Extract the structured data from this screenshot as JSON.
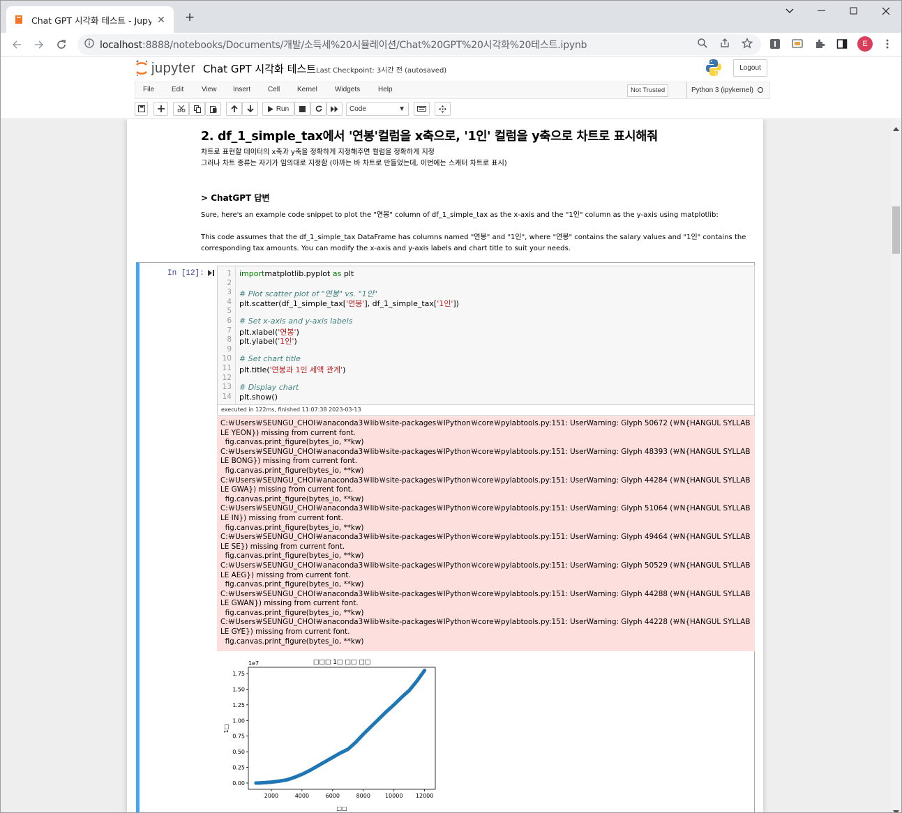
{
  "browser": {
    "tab_title": "Chat GPT 시각화 테스트 - Jupyter Notebook",
    "tab_close": "✕",
    "new_tab": "+",
    "url_host": "localhost",
    "url_path": ":8888/notebooks/Documents/개발/소득세%20시뮬레이션/Chat%20GPT%20시각화%20테스트.ipynb",
    "profile_initial": "E"
  },
  "jupyter": {
    "logo_text": "jupyter",
    "notebook_name": "Chat GPT 시각화 테스트",
    "checkpoint": "Last Checkpoint: 3시간 전   (autosaved)",
    "logout": "Logout",
    "menu": [
      "File",
      "Edit",
      "View",
      "Insert",
      "Cell",
      "Kernel",
      "Widgets",
      "Help"
    ],
    "not_trusted": "Not Trusted",
    "kernel": "Python 3 (ipykernel)",
    "run_label": "Run",
    "cell_type": "Code"
  },
  "markdown": {
    "heading": "2. df_1_simple_tax에서 '연봉'컬럼을 x축으로, '1인' 컬럼을 y축으로 차트로 표시해줘",
    "note1": "차트로 표현할 데이터의 x축과 y축을 정확하게 지정해주면 컬럼을 정확하게 지정",
    "note2": "그러나 차트 종류는 자기가 임의대로 지정함 (아까는 바 차트로 만들었는데, 이번에는 스캐터 차트로 표시)",
    "subheading": "> ChatGPT 답변",
    "para1": "Sure, here's an example code snippet to plot the \"연봉\" column of df_1_simple_tax as the x-axis and the \"1인\" column as the y-axis using matplotlib:",
    "para2a": "This code assumes that the df_1_simple_tax DataFrame has columns named \"연봉\" and \"1인\", where \"연봉\" contains the salary values and \"1인\" contains the",
    "para2b": "corresponding tax amounts. You can modify the x-axis and y-axis labels and chart title to suit your needs."
  },
  "cell": {
    "prompt": "In [12]:",
    "exec_time": "executed in 122ms, finished 11:07:38 2023-03-13",
    "code": [
      {
        "n": "1",
        "parts": [
          [
            "kw",
            "import"
          ],
          [
            "",
            "matplotlib.pyplot "
          ],
          [
            "kw",
            "as"
          ],
          [
            "",
            " plt"
          ]
        ]
      },
      {
        "n": "2",
        "parts": []
      },
      {
        "n": "3",
        "parts": [
          [
            "cm",
            "# Plot scatter plot of \"연봉\" vs. \"1인\""
          ]
        ]
      },
      {
        "n": "4",
        "parts": [
          [
            "",
            "plt.scatter(df_1_simple_tax["
          ],
          [
            "st",
            "'연봉'"
          ],
          [
            "",
            "], df_1_simple_tax["
          ],
          [
            "st",
            "'1인'"
          ],
          [
            "",
            "])"
          ]
        ]
      },
      {
        "n": "5",
        "parts": []
      },
      {
        "n": "6",
        "parts": [
          [
            "cm",
            "# Set x-axis and y-axis labels"
          ]
        ]
      },
      {
        "n": "7",
        "parts": [
          [
            "",
            "plt.xlabel("
          ],
          [
            "st",
            "'연봉'"
          ],
          [
            "",
            ")"
          ]
        ]
      },
      {
        "n": "8",
        "parts": [
          [
            "",
            "plt.ylabel("
          ],
          [
            "st",
            "'1인'"
          ],
          [
            "",
            ")"
          ]
        ]
      },
      {
        "n": "9",
        "parts": []
      },
      {
        "n": "10",
        "parts": [
          [
            "cm",
            "# Set chart title"
          ]
        ]
      },
      {
        "n": "11",
        "parts": [
          [
            "",
            "plt.title("
          ],
          [
            "st",
            "'연봉과 1인 세액 관계'"
          ],
          [
            "",
            ")"
          ]
        ]
      },
      {
        "n": "12",
        "parts": []
      },
      {
        "n": "13",
        "parts": [
          [
            "cm",
            "# Display chart"
          ]
        ]
      },
      {
        "n": "14",
        "parts": [
          [
            "",
            "plt.show()"
          ]
        ]
      }
    ],
    "stderr": [
      "C:￦Users￦SEUNGU_CHOI￦anaconda3￦lib￦site-packages￦IPython￦core￦pylabtools.py:151: UserWarning: Glyph 50672 (￦N{HANGUL SYLLAB",
      "LE YEON}) missing from current font.",
      "  fig.canvas.print_figure(bytes_io, **kw)",
      "C:￦Users￦SEUNGU_CHOI￦anaconda3￦lib￦site-packages￦IPython￦core￦pylabtools.py:151: UserWarning: Glyph 48393 (￦N{HANGUL SYLLAB",
      "LE BONG}) missing from current font.",
      "  fig.canvas.print_figure(bytes_io, **kw)",
      "C:￦Users￦SEUNGU_CHOI￦anaconda3￦lib￦site-packages￦IPython￦core￦pylabtools.py:151: UserWarning: Glyph 44284 (￦N{HANGUL SYLLAB",
      "LE GWA}) missing from current font.",
      "  fig.canvas.print_figure(bytes_io, **kw)",
      "C:￦Users￦SEUNGU_CHOI￦anaconda3￦lib￦site-packages￦IPython￦core￦pylabtools.py:151: UserWarning: Glyph 51064 (￦N{HANGUL SYLLAB",
      "LE IN}) missing from current font.",
      "  fig.canvas.print_figure(bytes_io, **kw)",
      "C:￦Users￦SEUNGU_CHOI￦anaconda3￦lib￦site-packages￦IPython￦core￦pylabtools.py:151: UserWarning: Glyph 49464 (￦N{HANGUL SYLLAB",
      "LE SE}) missing from current font.",
      "  fig.canvas.print_figure(bytes_io, **kw)",
      "C:￦Users￦SEUNGU_CHOI￦anaconda3￦lib￦site-packages￦IPython￦core￦pylabtools.py:151: UserWarning: Glyph 50529 (￦N{HANGUL SYLLAB",
      "LE AEG}) missing from current font.",
      "  fig.canvas.print_figure(bytes_io, **kw)",
      "C:￦Users￦SEUNGU_CHOI￦anaconda3￦lib￦site-packages￦IPython￦core￦pylabtools.py:151: UserWarning: Glyph 44288 (￦N{HANGUL SYLLAB",
      "LE GWAN}) missing from current font.",
      "  fig.canvas.print_figure(bytes_io, **kw)",
      "C:￦Users￦SEUNGU_CHOI￦anaconda3￦lib￦site-packages￦IPython￦core￦pylabtools.py:151: UserWarning: Glyph 44228 (￦N{HANGUL SYLLAB",
      "LE GYE}) missing from current font.",
      "  fig.canvas.print_figure(bytes_io, **kw)"
    ]
  },
  "chart_data": {
    "type": "scatter",
    "title": "□□□ 1□ □□ □□",
    "xlabel": "□□",
    "ylabel": "1□",
    "y_offset_label": "1e7",
    "xlim": [
      500,
      12700
    ],
    "ylim": [
      -0.1,
      1.85
    ],
    "xticks": [
      2000,
      4000,
      6000,
      8000,
      10000,
      12000
    ],
    "yticks": [
      0.0,
      0.25,
      0.5,
      0.75,
      1.0,
      1.25,
      1.5,
      1.75
    ],
    "ytick_labels": [
      "0.00",
      "0.25",
      "0.50",
      "0.75",
      "1.00",
      "1.25",
      "1.50",
      "1.75"
    ],
    "marker_color": "#1f77b4",
    "series": [
      {
        "x": [
          1000,
          1500,
          2000,
          2500,
          3000,
          3500,
          4000,
          4500,
          5000,
          5500,
          6000,
          6500,
          7000,
          7500,
          8000,
          8500,
          9000,
          9500,
          10000,
          10500,
          11000,
          11500,
          12000
        ],
        "y": [
          0.0,
          0.005,
          0.015,
          0.03,
          0.05,
          0.09,
          0.14,
          0.2,
          0.27,
          0.34,
          0.41,
          0.48,
          0.54,
          0.65,
          0.78,
          0.9,
          1.02,
          1.14,
          1.25,
          1.37,
          1.48,
          1.63,
          1.8
        ]
      }
    ]
  }
}
